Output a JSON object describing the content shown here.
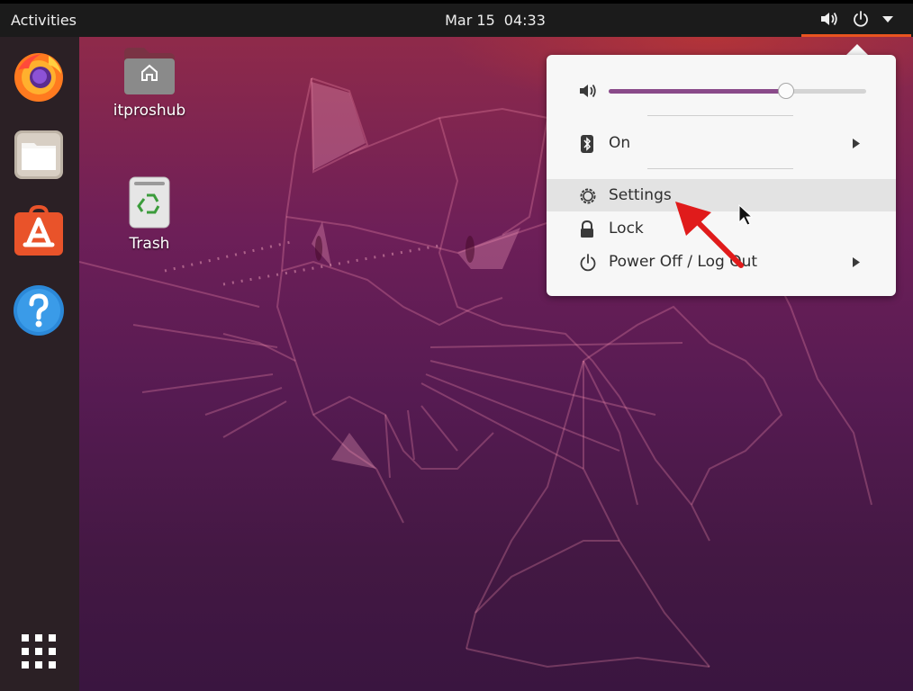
{
  "topbar": {
    "activities_label": "Activities",
    "date": "Mar 15",
    "time": "04:33",
    "indicators": [
      "volume-icon",
      "power-icon",
      "chevron-down-icon"
    ],
    "accent_color": "#e95420"
  },
  "dock": {
    "items": [
      {
        "name": "firefox",
        "icon": "firefox-icon"
      },
      {
        "name": "files",
        "icon": "files-icon"
      },
      {
        "name": "ubuntu-software",
        "icon": "software-store-icon"
      },
      {
        "name": "help",
        "icon": "help-icon"
      }
    ],
    "show_apps_icon": "grid-icon"
  },
  "desktop": {
    "icons": [
      {
        "label": "itproshub",
        "icon": "home-folder-icon"
      },
      {
        "label": "Trash",
        "icon": "trash-icon"
      }
    ]
  },
  "system_menu": {
    "volume_level": 0.69,
    "items": [
      {
        "label": "On",
        "icon": "bluetooth-icon",
        "submenu": true
      },
      {
        "label": "Settings",
        "icon": "settings-gear-icon",
        "submenu": false,
        "highlighted": true
      },
      {
        "label": "Lock",
        "icon": "lock-icon",
        "submenu": false
      },
      {
        "label": "Power Off / Log Out",
        "icon": "power-icon",
        "submenu": true
      }
    ],
    "slider_color": "#8a4a8a"
  },
  "annotation": {
    "arrow_color": "#e01b1b"
  }
}
